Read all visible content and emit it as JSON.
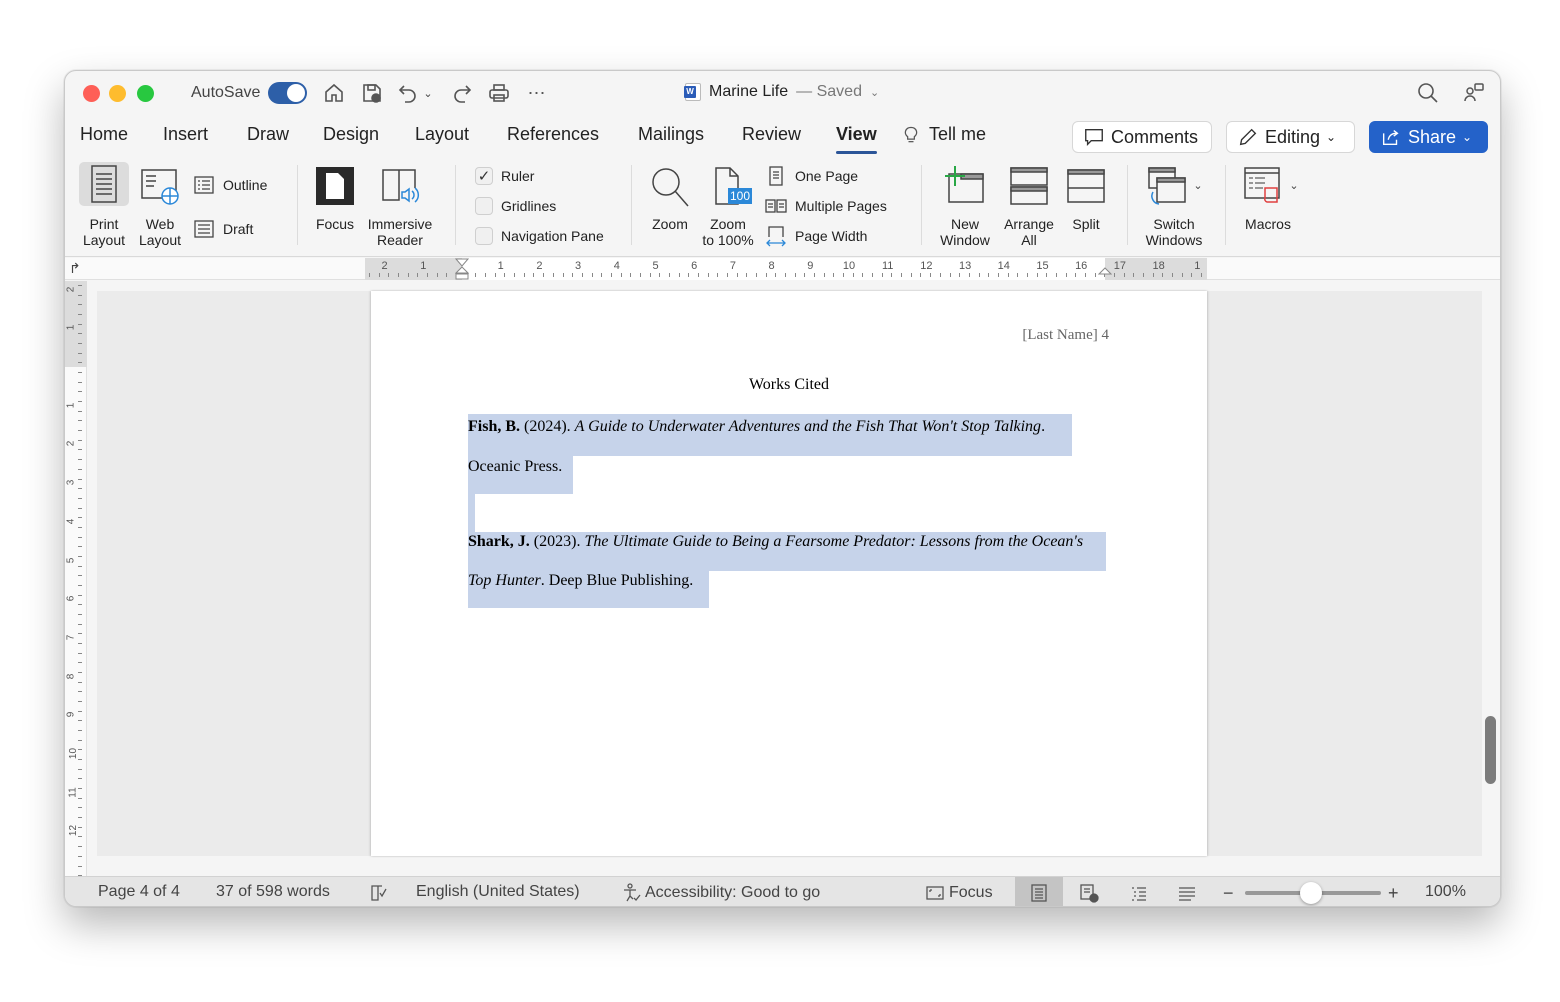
{
  "titlebar": {
    "autosave_label": "AutoSave",
    "autosave_on": true,
    "doc_name": "Marine Life",
    "doc_status": "— Saved",
    "icons": [
      "home-icon",
      "save-icon",
      "undo-icon",
      "redo-icon",
      "print-icon",
      "more-icon",
      "search-icon",
      "collaborate-icon"
    ]
  },
  "tabs": [
    {
      "label": "Home"
    },
    {
      "label": "Insert"
    },
    {
      "label": "Draw"
    },
    {
      "label": "Design"
    },
    {
      "label": "Layout"
    },
    {
      "label": "References"
    },
    {
      "label": "Mailings"
    },
    {
      "label": "Review"
    },
    {
      "label": "View",
      "active": true
    },
    {
      "label": "Tell me"
    }
  ],
  "actions": {
    "comments": "Comments",
    "editing": "Editing",
    "share": "Share"
  },
  "ribbon": {
    "print_layout": [
      "Print",
      "Layout"
    ],
    "web_layout": [
      "Web",
      "Layout"
    ],
    "outline": "Outline",
    "draft": "Draft",
    "focus": "Focus",
    "immersive_reader": [
      "Immersive",
      "Reader"
    ],
    "ruler": {
      "label": "Ruler",
      "checked": true
    },
    "gridlines": {
      "label": "Gridlines",
      "checked": false
    },
    "navigation_pane": {
      "label": "Navigation Pane",
      "checked": false
    },
    "zoom": "Zoom",
    "zoom_100": [
      "Zoom",
      "to 100%"
    ],
    "zoom_100_badge": "100",
    "one_page": "One Page",
    "multiple_pages": "Multiple Pages",
    "page_width": "Page Width",
    "new_window": [
      "New",
      "Window"
    ],
    "arrange_all": [
      "Arrange",
      "All"
    ],
    "split": "Split",
    "switch_windows": [
      "Switch",
      "Windows"
    ],
    "macros": "Macros"
  },
  "ruler": {
    "horizontal_labels": [
      "2",
      "1",
      "1",
      "2",
      "3",
      "4",
      "5",
      "6",
      "7",
      "8",
      "9",
      "10",
      "11",
      "12",
      "13",
      "14",
      "15",
      "16",
      "17",
      "18",
      "1"
    ],
    "vertical_labels": [
      "2",
      "1",
      "1",
      "2",
      "3",
      "4",
      "5",
      "6",
      "7",
      "8",
      "9",
      "10",
      "11",
      "12"
    ]
  },
  "document": {
    "header": "[Last Name] 4",
    "title": "Works Cited",
    "entries": [
      {
        "author": "Fish, B.",
        "year": " (2024). ",
        "title_line1": "A Guide to Underwater Adventures and the Fish That Won't Stop Talking",
        "punct1": ".",
        "line2_plain": "Oceanic Press."
      },
      {
        "author": "Shark, J.",
        "year": " (2023). ",
        "title_line1": "The Ultimate Guide to Being a Fearsome Predator: Lessons from the Ocean's",
        "title_line2": "Top Hunter",
        "line2_plain": ". Deep Blue Publishing."
      }
    ],
    "selection_color": "#c6d3ea"
  },
  "statusbar": {
    "page": "Page 4 of 4",
    "words": "37 of 598 words",
    "language": "English (United States)",
    "accessibility": "Accessibility: Good to go",
    "focus": "Focus",
    "zoom_level": "100%",
    "zoom_percent": 100
  },
  "colors": {
    "accent": "#2462c9",
    "active_tab_underline": "#2b5598"
  }
}
